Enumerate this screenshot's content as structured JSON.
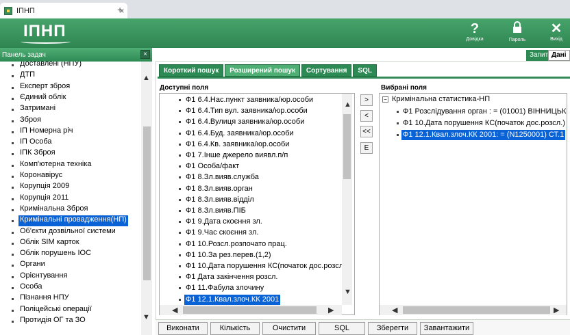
{
  "browser": {
    "tab_title": "ІПНП",
    "tab_close": "×",
    "new_tab": "+"
  },
  "header": {
    "logo": "ІПНП",
    "help": {
      "icon": "?",
      "label": "Довідка"
    },
    "password": {
      "icon": "🔒",
      "label": "Пароль"
    },
    "exit": {
      "icon": "✕",
      "label": "Вихід"
    }
  },
  "taskbar": {
    "title": "Панель задач",
    "close": "×",
    "items": [
      "Доставлені (НПУ)",
      "ДТП",
      "Експерт зброя",
      "Єдиний облік",
      "Затримані",
      "Зброя",
      "ІП Номерна річ",
      "ІП Особа",
      "ІПК Зброя",
      "Комп'ютерна техніка",
      "Коронавірус",
      "Корупція 2009",
      "Корупція 2011",
      "Кримінальна Зброя",
      "Кримінальні провадження(НП)",
      "Об'єкти дозвільної системи",
      "Облік SIM карток",
      "Облік порушень ІОС",
      "Органи",
      "Орієнтування",
      "Особа",
      "Пізнання НПУ",
      "Поліцейські операції",
      "Протидія ОГ та ЗО"
    ],
    "selected_index": 14
  },
  "toolbar": {
    "request_label": "Запит",
    "data_label": "Дані",
    "search_value": ""
  },
  "tabs": [
    "Короткий пошук",
    "Розширений пошук",
    "Сортування",
    "SQL"
  ],
  "active_tab": 1,
  "available": {
    "caption": "Доступні поля",
    "items": [
      "Ф1 6.4.Нас.пункт заявника/юр.особи",
      "Ф1 6.4.Тип вул. заявника/юр.особи",
      "Ф1 6.4.Вулиця заявника/юр.особи",
      "Ф1 6.4.Буд. заявника/юр.особи",
      "Ф1 6.4.Кв. заявника/юр.особи",
      "Ф1 7.Інше джерело виявл.п/п",
      "Ф1 Особа/факт",
      "Ф1 8.Зл.вияв.служба",
      "Ф1 8.Зл.вияв.орган",
      "Ф1 8.Зл.вияв.відділ",
      "Ф1 8.Зл.вияв.ПІБ",
      "Ф1 9.Дата скоєння зл.",
      "Ф1 9.Час скоєння зл.",
      "Ф1 10.Розсл.розпочато прац.",
      "Ф1 10.За рез.перев.(1,2)",
      "Ф1 10.Дата порушення КС(початок дос.розсл",
      "Ф1 Дата закінчення розсл.",
      "Ф1 11.Фабула злочину",
      "Ф1 12.1.Квал.злоч.КК 2001"
    ],
    "selected_index": 18
  },
  "move_buttons": [
    ">",
    "<",
    "<<",
    "E"
  ],
  "selected_fields": {
    "caption": "Вибрані поля",
    "root": "Кримінальна статистика-НП",
    "tree_toggle": "−",
    "items": [
      "Ф1 Розслідування орган : = (01001) ВІННИЦЬК",
      "Ф1 10.Дата порушення КС(початок дос.розсл.)",
      "Ф1 12.1.Квал.злоч.КК 2001: = (N1250001) СТ.1"
    ],
    "selected_index": 2
  },
  "bottom_buttons": [
    "Виконати",
    "Кількість",
    "Очистити",
    "SQL",
    "Зберегти",
    "Завантажити"
  ],
  "scroll_arrows": {
    "up": "▲",
    "down": "▼",
    "left": "◀",
    "right": "▶"
  }
}
